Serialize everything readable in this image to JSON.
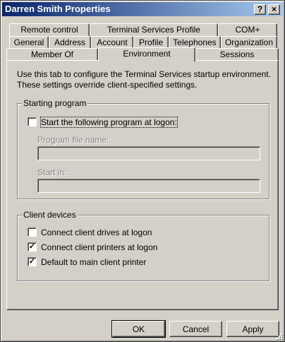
{
  "window": {
    "title": "Darren Smith Properties",
    "help_label": "?",
    "close_label": "×"
  },
  "tabs": {
    "row1": [
      "Remote control",
      "Terminal Services Profile",
      "COM+"
    ],
    "row2": [
      "General",
      "Address",
      "Account",
      "Profile",
      "Telephones",
      "Organization"
    ],
    "row3": [
      "Member Of",
      "Environment",
      "Sessions"
    ],
    "active": "Environment"
  },
  "description": "Use this tab to configure the Terminal Services startup environment. These settings override client-specified settings.",
  "starting_program": {
    "legend": "Starting program",
    "start_checkbox": {
      "label": "Start the following program at logon:",
      "checked": false,
      "mark": ""
    },
    "program_file_label": "Program file name:",
    "program_file_value": "",
    "start_in_label": "Start in:",
    "start_in_value": ""
  },
  "client_devices": {
    "legend": "Client devices",
    "drives": {
      "label": "Connect client drives at logon",
      "checked": false,
      "mark": ""
    },
    "printers": {
      "label": "Connect client printers at logon",
      "checked": true,
      "mark": "✓"
    },
    "default_printer": {
      "label": "Default to main client printer",
      "checked": true,
      "mark": "✓"
    }
  },
  "buttons": {
    "ok": "OK",
    "cancel": "Cancel",
    "apply": "Apply"
  },
  "colors": {
    "face": "#d4d0c8",
    "title_start": "#0a246a",
    "title_end": "#a6caf0"
  }
}
